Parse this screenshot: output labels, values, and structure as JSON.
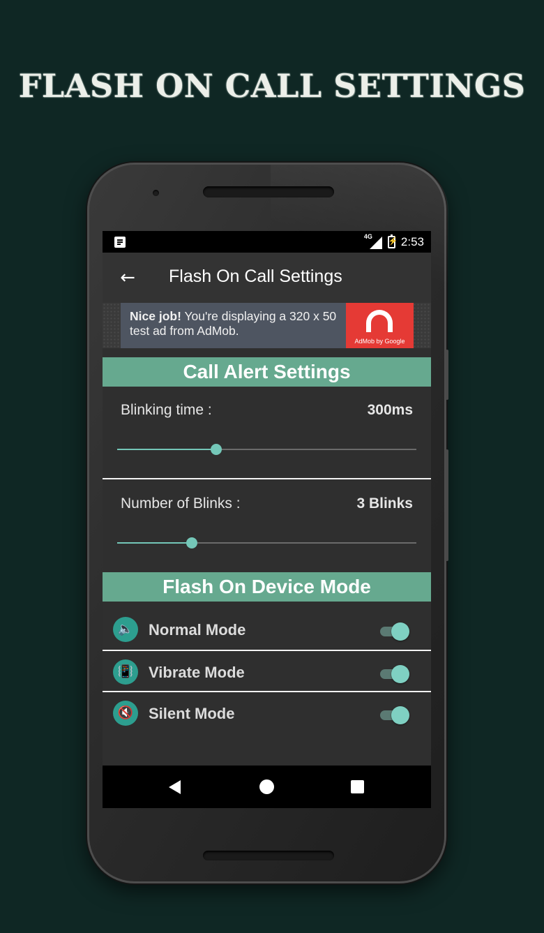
{
  "headline": "FLASH ON CALL SETTINGS",
  "status_bar": {
    "network": "4G",
    "time": "2:53"
  },
  "app_bar": {
    "back_icon": "arrow-left-icon",
    "title": "Flash On Call Settings"
  },
  "ad_banner": {
    "bold": "Nice job!",
    "text": " You're displaying a 320 x 50 test ad from AdMob.",
    "logo_caption": "AdMob by Google",
    "logo_color": "#e53a35"
  },
  "call_alert": {
    "header": "Call Alert Settings",
    "blinking_time": {
      "label": "Blinking time :",
      "value": "300ms",
      "slider_fraction": 0.33
    },
    "blink_count": {
      "label": "Number of Blinks :",
      "value": "3 Blinks",
      "slider_fraction": 0.25
    }
  },
  "device_mode": {
    "header": "Flash On Device Mode",
    "modes": [
      {
        "label": "Normal Mode",
        "icon": "speaker-icon",
        "enabled": true
      },
      {
        "label": "Vibrate Mode",
        "icon": "vibrate-icon",
        "enabled": true
      },
      {
        "label": "Silent Mode",
        "icon": "mute-icon",
        "enabled": true
      }
    ]
  },
  "colors": {
    "accent": "#66a98f",
    "slider": "#74c7b8",
    "background": "#0f2724"
  }
}
